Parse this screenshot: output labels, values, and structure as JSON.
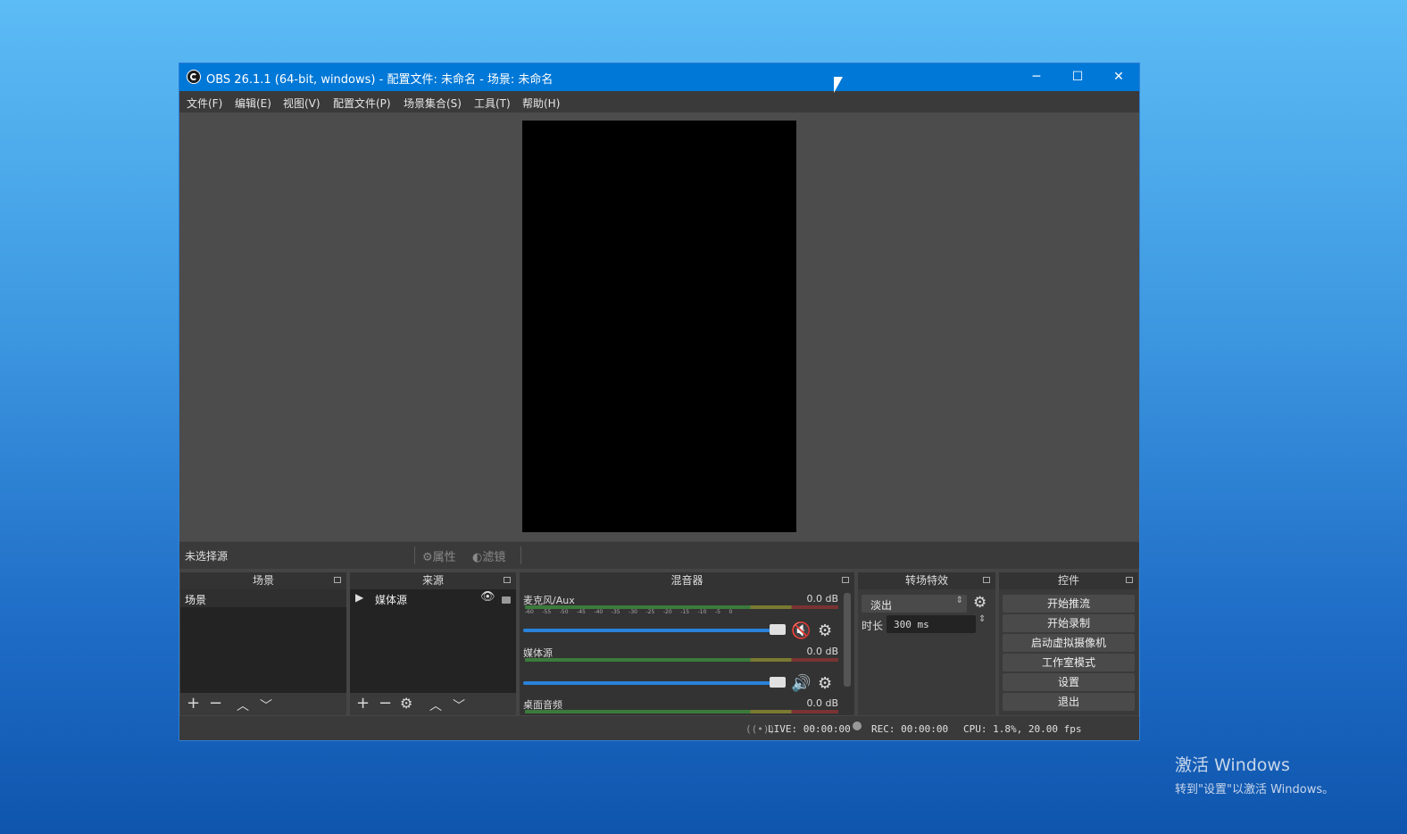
{
  "window": {
    "title": "OBS 26.1.1 (64-bit, windows) - 配置文件: 未命名 - 场景: 未命名",
    "controls": {
      "minimize": "─",
      "maximize": "☐",
      "close": "✕"
    }
  },
  "menu": [
    "文件(F)",
    "编辑(E)",
    "视图(V)",
    "配置文件(P)",
    "场景集合(S)",
    "工具(T)",
    "帮助(H)"
  ],
  "source_toolbar": {
    "no_source": "未选择源",
    "properties": "属性",
    "filters": "滤镜"
  },
  "scenes": {
    "title": "场景",
    "items": [
      "场景"
    ]
  },
  "sources": {
    "title": "来源",
    "items": [
      {
        "name": "媒体源",
        "visible": true,
        "locked": true
      }
    ]
  },
  "mixer": {
    "title": "混音器",
    "tracks": [
      {
        "name": "麦克风/Aux",
        "db": "0.0 dB",
        "muted": true
      },
      {
        "name": "媒体源",
        "db": "0.0 dB",
        "muted": false
      },
      {
        "name": "桌面音频",
        "db": "0.0 dB",
        "muted": false
      }
    ],
    "ticks": [
      "-60",
      "-55",
      "-50",
      "-45",
      "-40",
      "-35",
      "-30",
      "-25",
      "-20",
      "-15",
      "-10",
      "-5",
      "0"
    ]
  },
  "transitions": {
    "title": "转场特效",
    "selected": "淡出",
    "duration_label": "时长",
    "duration_value": "300 ms"
  },
  "controls": {
    "title": "控件",
    "buttons": [
      "开始推流",
      "开始录制",
      "启动虚拟摄像机",
      "工作室模式",
      "设置",
      "退出"
    ]
  },
  "status": {
    "live": "LIVE: 00:00:00",
    "rec": "REC: 00:00:00",
    "cpu": "CPU: 1.8%, 20.00 fps"
  },
  "watermark": {
    "line1": "激活 Windows",
    "line2": "转到\"设置\"以激活 Windows。"
  },
  "colors": {
    "accent": "#0078d7",
    "muted_red": "#e02020",
    "slider_blue": "#2a82da"
  }
}
